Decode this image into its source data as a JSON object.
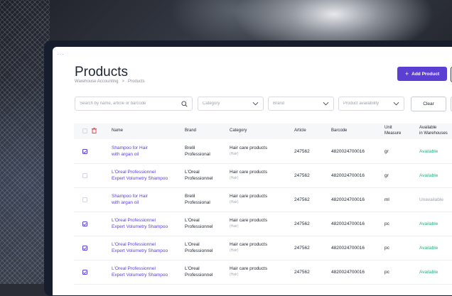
{
  "page": {
    "title": "Products",
    "breadcrumb": [
      "Warehouse Accounting",
      ">",
      "Products"
    ],
    "add_button": "Add Product",
    "add_icon": "plus-icon"
  },
  "filters": {
    "search_placeholder": "Search by name, article or barcode",
    "category_placeholder": "Category",
    "brand_placeholder": "Brand",
    "availability_placeholder": "Product availability",
    "clear_label": "Clear"
  },
  "table": {
    "columns": {
      "name": "Name",
      "brand": "Brand",
      "category": "Category",
      "article": "Article",
      "barcode": "Barcode",
      "unit_line1": "Unit",
      "unit_line2": "Measure",
      "avail_line1": "Available",
      "avail_line2": "in Warehouses"
    },
    "rows": [
      {
        "checked": true,
        "name1": "Shampoo for Hair",
        "name2": "with argan oil",
        "brand1": "Brelil",
        "brand2": "Professional",
        "category": "Hair care products",
        "sub": "(Hair)",
        "article": "247562",
        "barcode": "4820024700016",
        "unit": "gr",
        "availability": "Available",
        "available": true
      },
      {
        "checked": false,
        "name1": "L'Oreal Professionnel",
        "name2": "Expert Volumetry Shampoo",
        "brand1": "L'Oreal",
        "brand2": "Professionnel",
        "category": "Hair care products",
        "sub": "(Hair)",
        "article": "247562",
        "barcode": "4820024700016",
        "unit": "gr",
        "availability": "Available",
        "available": true
      },
      {
        "checked": false,
        "name1": "Shampoo for Hair",
        "name2": "with argan oil",
        "brand1": "Brelil",
        "brand2": "Professional",
        "category": "Hair care products",
        "sub": "(Hair)",
        "article": "247562",
        "barcode": "4820024700016",
        "unit": "ml",
        "availability": "Unavailable",
        "available": false
      },
      {
        "checked": true,
        "name1": "L'Oreal Professionnel",
        "name2": "Expert Volumetry Shampoo",
        "brand1": "L'Oreal",
        "brand2": "Professionnel",
        "category": "Hair care products",
        "sub": "(Hair)",
        "article": "247562",
        "barcode": "4820024700016",
        "unit": "pc",
        "availability": "Available",
        "available": true
      },
      {
        "checked": true,
        "name1": "L'Oreal Professionnel",
        "name2": "Expert Volumetry Shampoo",
        "brand1": "L'Oreal",
        "brand2": "Professionnel",
        "category": "Hair care products",
        "sub": "(Hair)",
        "article": "247562",
        "barcode": "4820024700016",
        "unit": "pc",
        "availability": "Available",
        "available": true
      },
      {
        "checked": true,
        "name1": "L'Oreal Professionnel",
        "name2": "Expert Volumetry Shampoo",
        "brand1": "L'Oreal",
        "brand2": "Professionnel",
        "category": "Hair care products",
        "sub": "(Hair)",
        "article": "247562",
        "barcode": "4820024700016",
        "unit": "pc",
        "availability": "Available",
        "available": true
      }
    ]
  },
  "colors": {
    "accent": "#5b3fd3",
    "available": "#21b17a",
    "delete": "#e5484d"
  }
}
